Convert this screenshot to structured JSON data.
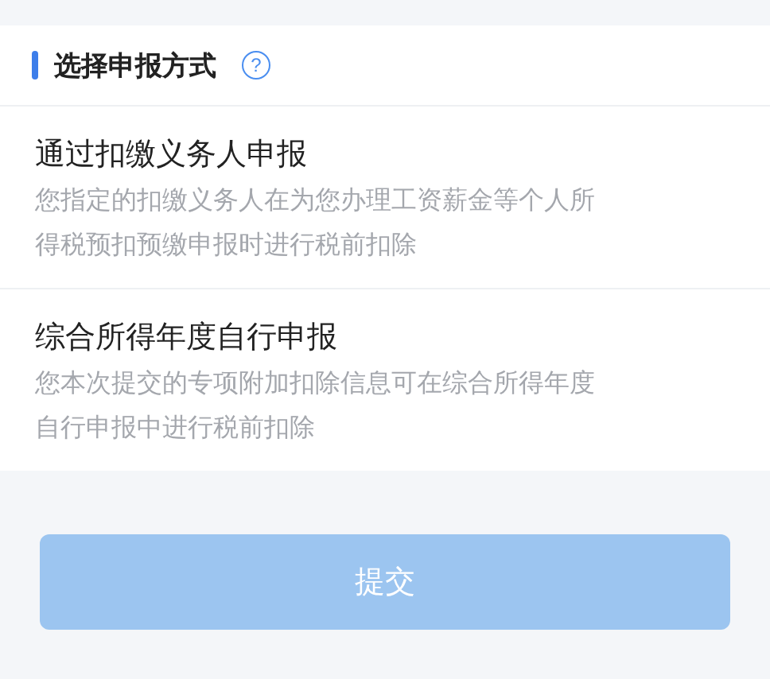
{
  "section": {
    "title": "选择申报方式",
    "help_icon": "?"
  },
  "options": [
    {
      "title": "通过扣缴义务人申报",
      "description": "您指定的扣缴义务人在为您办理工资薪金等个人所得税预扣预缴申报时进行税前扣除"
    },
    {
      "title": "综合所得年度自行申报",
      "description": "您本次提交的专项附加扣除信息可在综合所得年度自行申报中进行税前扣除"
    }
  ],
  "submit": {
    "label": "提交",
    "disabled": true
  }
}
